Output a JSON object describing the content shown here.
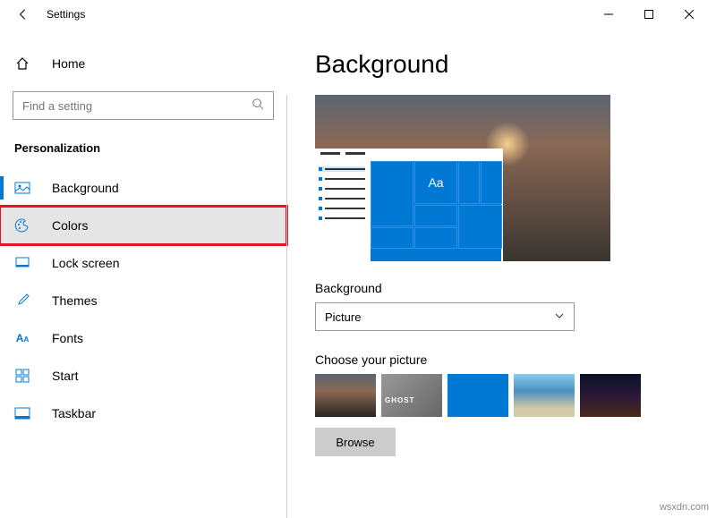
{
  "window": {
    "title": "Settings"
  },
  "home": {
    "label": "Home"
  },
  "search": {
    "placeholder": "Find a setting"
  },
  "section": "Personalization",
  "menu": [
    {
      "label": "Background"
    },
    {
      "label": "Colors"
    },
    {
      "label": "Lock screen"
    },
    {
      "label": "Themes"
    },
    {
      "label": "Fonts"
    },
    {
      "label": "Start"
    },
    {
      "label": "Taskbar"
    }
  ],
  "main": {
    "title": "Background",
    "preview_aa": "Aa",
    "dropdown_label": "Background",
    "dropdown_value": "Picture",
    "choose_label": "Choose your picture",
    "browse": "Browse"
  },
  "watermark": "wsxdn.com"
}
